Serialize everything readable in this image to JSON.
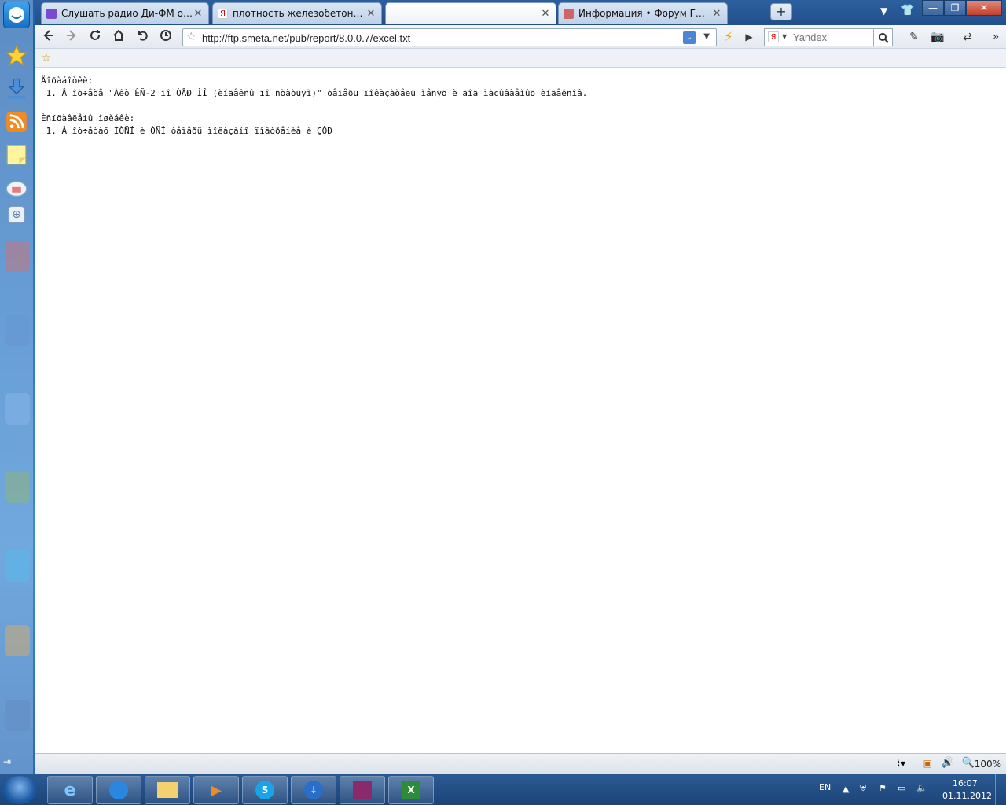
{
  "tabs": [
    {
      "label": "Слушать радио Ди-ФМ онла...",
      "active": false
    },
    {
      "label": "плотность железобетона — ...",
      "active": false
    },
    {
      "label": "",
      "active": true
    },
    {
      "label": "Информация • Форум ГК \"Ст...",
      "active": false
    }
  ],
  "url": "http://ftp.smeta.net/pub/report/8.0.0.7/excel.txt",
  "search": {
    "placeholder": "Yandex"
  },
  "content_text": "Äîðàáîòêè:\n 1. Â îò÷åòå \"Àêò ÊÑ-2 ïî ÒÅÐ ÌÎ (èíäåêñû ïî ñòàòüÿì)\" òåïåðü ïîêàçàòåëü ìåñÿö è ãîä ìàçûâàåìûõ èíäåêñîâ.\n\nÈñïðàâëåíû îøèáêè:\n 1. Â îò÷åòàõ ÌÒÑÍ è ÒÑÍ òåïåðü ïîêàçàíî ïîâòðåíèå è ÇÒÐ",
  "status": {
    "zoom": "100%"
  },
  "tray": {
    "lang": "EN",
    "time": "16:07",
    "date": "01.11.2012"
  },
  "icons": {
    "back": "back-arrow-icon",
    "forward": "forward-arrow-icon",
    "reload": "reload-icon",
    "home": "home-icon",
    "undo": "undo-icon",
    "history": "clock-icon"
  }
}
